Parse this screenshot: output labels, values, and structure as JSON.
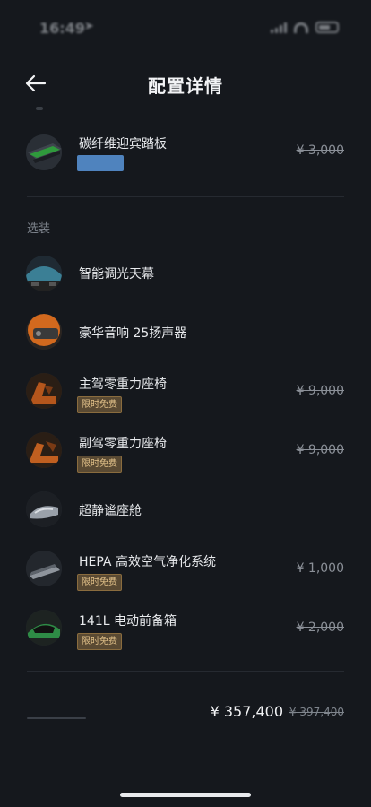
{
  "status": {
    "time": "16:49",
    "location_icon": "location-arrow-icon"
  },
  "header": {
    "title": "配置详情",
    "back_icon": "arrow-left-icon"
  },
  "standard_items": [
    {
      "name": "碳纤维迎宾踏板",
      "price": "¥ 3,000",
      "badge_color": "#4f83be"
    }
  ],
  "optional_section": {
    "label": "选装",
    "items": [
      {
        "name": "智能调光天幕",
        "price": "",
        "badge": ""
      },
      {
        "name": "豪华音响 25扬声器",
        "price": "",
        "badge": ""
      },
      {
        "name": "主驾零重力座椅",
        "price": "¥ 9,000",
        "badge": "限时免费"
      },
      {
        "name": "副驾零重力座椅",
        "price": "¥ 9,000",
        "badge": "限时免费"
      },
      {
        "name": "超静谧座舱",
        "price": "",
        "badge": ""
      },
      {
        "name": "HEPA 高效空气净化系统",
        "price": "¥ 1,000",
        "badge": "限时免费"
      },
      {
        "name": "141L 电动前备箱",
        "price": "¥ 2,000",
        "badge": "限时免费"
      }
    ]
  },
  "total": {
    "current": "¥ 357,400",
    "original": "¥ 397,400"
  },
  "colors": {
    "background": "#15181d",
    "free_badge_bg": "#5a4a33",
    "free_badge_text": "#e3c28a",
    "accent_blue": "#4f83be"
  }
}
